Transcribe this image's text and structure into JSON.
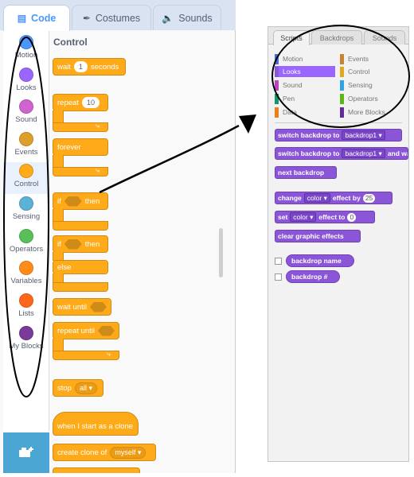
{
  "tabs": {
    "code": {
      "label": "Code",
      "icon": "code-icon"
    },
    "costumes": {
      "label": "Costumes",
      "icon": "brush-icon"
    },
    "sounds": {
      "label": "Sounds",
      "icon": "speaker-icon"
    }
  },
  "categories": [
    {
      "label": "Motion",
      "color": "#4c97ff"
    },
    {
      "label": "Looks",
      "color": "#9966ff"
    },
    {
      "label": "Sound",
      "color": "#cf63cf"
    },
    {
      "label": "Events",
      "color": "#de9e2e"
    },
    {
      "label": "Control",
      "color": "#ffab19"
    },
    {
      "label": "Sensing",
      "color": "#5cb1d6"
    },
    {
      "label": "Operators",
      "color": "#59c059"
    },
    {
      "label": "Variables",
      "color": "#ff8c1a"
    },
    {
      "label": "Lists",
      "color": "#ff661a"
    },
    {
      "label": "My Blocks",
      "color": "#7a3a98"
    }
  ],
  "section_title": "Control",
  "blocks": {
    "wait": {
      "pre": "wait",
      "value": "1",
      "post": "seconds"
    },
    "repeat": {
      "label": "repeat",
      "value": "10"
    },
    "forever": {
      "label": "forever"
    },
    "if_then": {
      "pre": "if",
      "post": "then"
    },
    "if_else": {
      "pre": "if",
      "post": "then",
      "else": "else"
    },
    "wait_until": {
      "label": "wait until"
    },
    "repeat_until": {
      "label": "repeat until"
    },
    "stop": {
      "label": "stop",
      "option": "all"
    },
    "start_clone": {
      "label": "when I start as a clone"
    },
    "create_clone": {
      "label": "create clone of",
      "option": "myself"
    }
  },
  "right_panel": {
    "tabs": [
      "Scripts",
      "Backdrops",
      "Sounds"
    ],
    "categories": [
      {
        "label": "Motion",
        "color": "#4a6cd4"
      },
      {
        "label": "Looks",
        "color": "#8a55d7"
      },
      {
        "label": "Sound",
        "color": "#bb42c3"
      },
      {
        "label": "Pen",
        "color": "#0e9a6c"
      },
      {
        "label": "Data",
        "color": "#ee7d16"
      },
      {
        "label": "Events",
        "color": "#c88330"
      },
      {
        "label": "Control",
        "color": "#e1a91a"
      },
      {
        "label": "Sensing",
        "color": "#2ca5e2"
      },
      {
        "label": "Operators",
        "color": "#5cb712"
      },
      {
        "label": "More Blocks",
        "color": "#632d99"
      }
    ],
    "blocks": {
      "switch1": {
        "label": "switch backdrop to",
        "option": "backdrop1"
      },
      "switch2": {
        "label": "switch backdrop to",
        "option": "backdrop1",
        "suffix": "and wait"
      },
      "next": {
        "label": "next backdrop"
      },
      "change": {
        "pre": "change",
        "option": "color",
        "mid": "effect by",
        "value": "25"
      },
      "set": {
        "pre": "set",
        "option": "color",
        "mid": "effect to",
        "value": "0"
      },
      "clear": {
        "label": "clear graphic effects"
      },
      "name": {
        "label": "backdrop name"
      },
      "number": {
        "label": "backdrop #"
      }
    }
  }
}
